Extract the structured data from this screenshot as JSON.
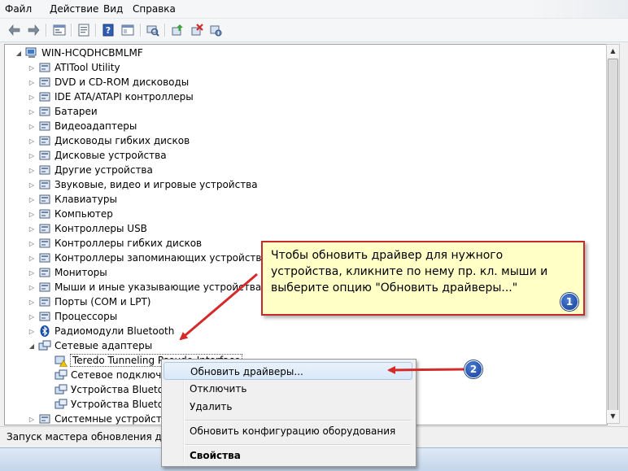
{
  "menu": {
    "file": "Файл",
    "action": "Действие",
    "view": "Вид",
    "help": "Справка"
  },
  "toolbar": {
    "buttons": [
      "back-icon",
      "forward-icon",
      "show-hide-tree-icon",
      "properties-icon",
      "help-icon",
      "console-icon",
      "scan-hardware-icon",
      "update-driver-icon",
      "uninstall-icon",
      "disable-icon"
    ]
  },
  "tree": {
    "root": "WIN-HCQDHCBMLMF",
    "items": [
      "ATITool Utility",
      "DVD и CD-ROM дисководы",
      "IDE ATA/ATAPI контроллеры",
      "Батареи",
      "Видеоадаптеры",
      "Дисководы гибких дисков",
      "Дисковые устройства",
      "Другие устройства",
      "Звуковые, видео и игровые устройства",
      "Клавиатуры",
      "Компьютер",
      "Контроллеры USB",
      "Контроллеры гибких дисков",
      "Контроллеры запоминающих устройств",
      "Мониторы",
      "Мыши и иные указывающие устройства",
      "Порты (COM и LPT)",
      "Процессоры",
      "Радиомодули Bluetooth",
      "Сетевые адаптеры"
    ],
    "network_children": [
      "Teredo Tunneling Pseudo-Interface",
      "Сетевое подключени",
      "Устройства Bluetoot",
      "Устройства Bluetoot"
    ],
    "last_item": "Системные устройства"
  },
  "status": {
    "text": "Запуск мастера обновления драйв"
  },
  "context_menu": {
    "items": [
      "Обновить драйверы...",
      "Отключить",
      "Удалить",
      "Обновить конфигурацию оборудования",
      "Свойства"
    ]
  },
  "callout": {
    "text": "Чтобы обновить драйвер для нужного устройства, кликните по нему пр. кл. мыши и выберите опцию \"Обновить драйверы...\"",
    "badge1": "1",
    "badge2": "2"
  },
  "colors": {
    "annotation_red": "#d42a2a",
    "callout_bg": "#ffffc6",
    "badge_blue": "#1f4fae"
  }
}
